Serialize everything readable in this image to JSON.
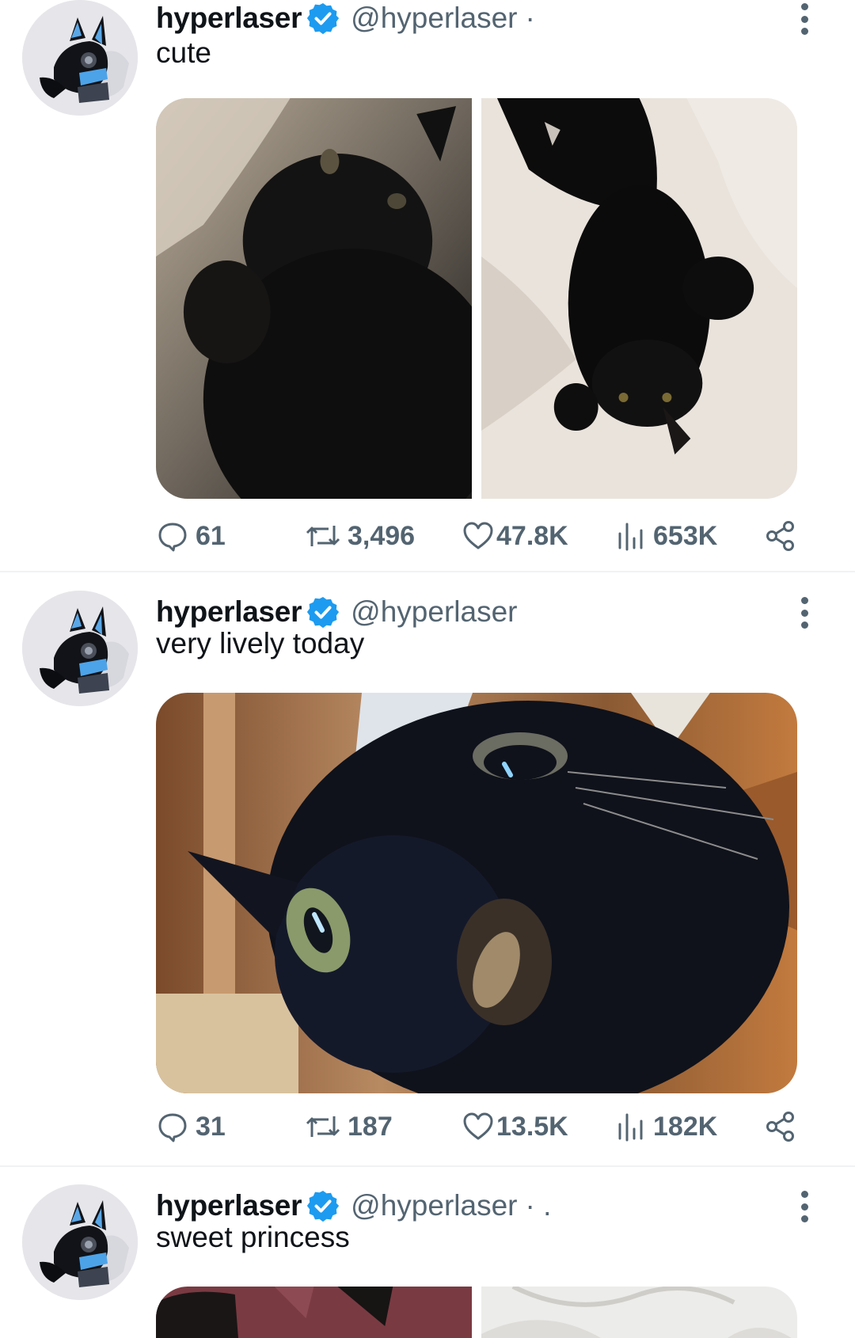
{
  "colors": {
    "accent": "#1d9bf0",
    "muted": "#536471",
    "text": "#0f1419",
    "divider": "#eff3f4"
  },
  "tweets": [
    {
      "author": "hyperlaser",
      "handle": "@hyperlaser",
      "suffix": "·",
      "text": "cute",
      "media": [
        "black-cat-lying-on-blanket",
        "black-cat-upside-down-on-bed"
      ],
      "stats": {
        "replies": "61",
        "retweets": "3,496",
        "likes": "47.8K",
        "views": "653K"
      }
    },
    {
      "author": "hyperlaser",
      "handle": "@hyperlaser",
      "suffix": "",
      "text": "very lively today",
      "media": [
        "black-cat-closeup-selfie"
      ],
      "stats": {
        "replies": "31",
        "retweets": "187",
        "likes": "13.5K",
        "views": "182K"
      }
    },
    {
      "author": "hyperlaser",
      "handle": "@hyperlaser",
      "suffix": "· .",
      "text": "sweet princess",
      "media": [
        "black-cat-on-red-fabric",
        "white-sheets"
      ],
      "stats": {}
    }
  ],
  "icons": {
    "avatar": "robot-cat-helmet-avatar",
    "verified": "verified-badge-icon",
    "more": "more-options-icon",
    "reply": "reply-icon",
    "retweet": "retweet-icon",
    "like": "heart-icon",
    "views": "views-chart-icon",
    "share": "share-icon"
  }
}
